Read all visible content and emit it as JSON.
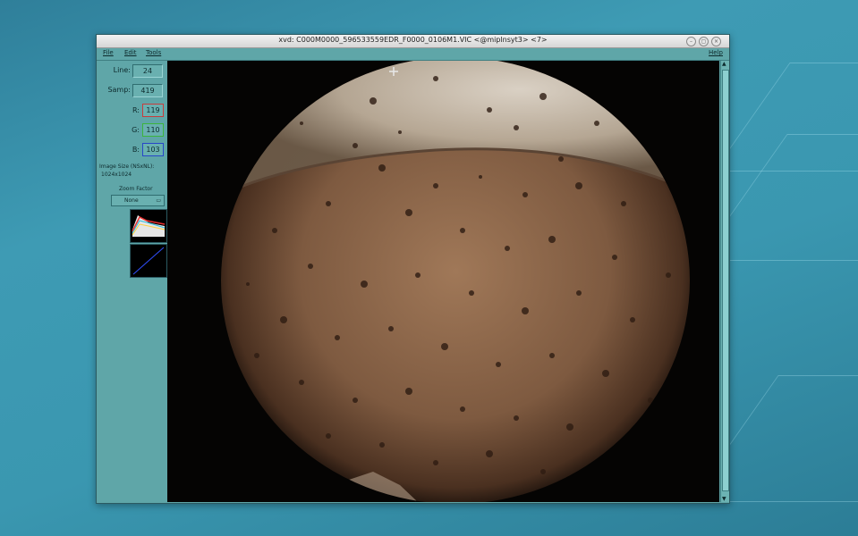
{
  "window": {
    "title": "xvd: C000M0000_596533559EDR_F0000_0106M1.VIC <@miplnsyt3> <7>"
  },
  "menu": {
    "file": "File",
    "edit": "Edit",
    "tools": "Tools",
    "help": "Help"
  },
  "panel": {
    "line_label": "Line:",
    "line_value": "24",
    "samp_label": "Samp:",
    "samp_value": "419",
    "r_label": "R:",
    "r_value": "119",
    "g_label": "G:",
    "g_value": "110",
    "b_label": "B:",
    "b_value": "103",
    "image_size_label": "Image Size (NSxNL):",
    "image_size_value": "1024x1024",
    "zoom_label": "Zoom Factor",
    "zoom_value": "None"
  },
  "icons": {
    "cursor": "crosshair-icon",
    "minimize": "minimize-icon",
    "maximize": "maximize-icon",
    "close": "close-icon"
  },
  "colors": {
    "r_border": "#c83c3c",
    "g_border": "#3cb43c",
    "b_border": "#2846c8",
    "panel": "#5fa6a8"
  }
}
